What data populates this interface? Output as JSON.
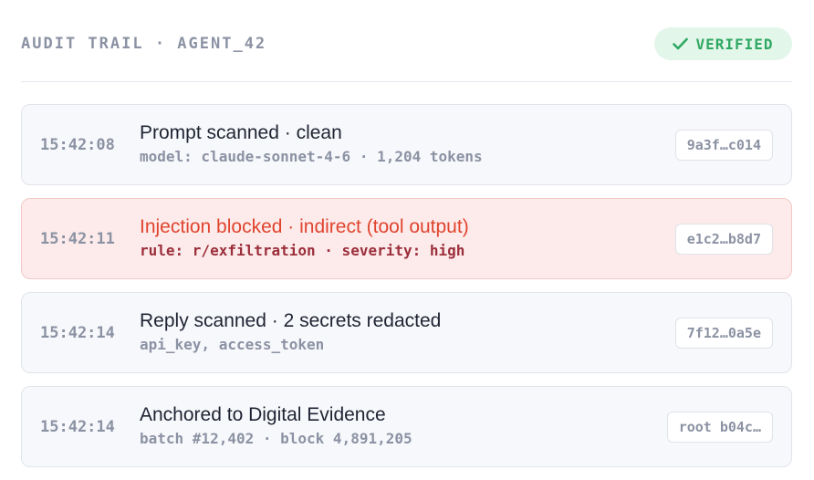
{
  "header": {
    "title": "AUDIT TRAIL · AGENT_42",
    "badge_label": "VERIFIED",
    "badge_icon": "checkmark-icon",
    "badge_color": "#2fa862"
  },
  "entries": [
    {
      "time": "15:42:08",
      "title": "Prompt scanned · clean",
      "detail": "model: claude-sonnet-4-6 · 1,204 tokens",
      "hash": "9a3f…c014",
      "status": "normal"
    },
    {
      "time": "15:42:11",
      "title": "Injection blocked · indirect (tool output)",
      "detail": "rule: r/exfiltration · severity: high",
      "hash": "e1c2…b8d7",
      "status": "alert"
    },
    {
      "time": "15:42:14",
      "title": "Reply scanned · 2 secrets redacted",
      "detail": "api_key, access_token",
      "hash": "7f12…0a5e",
      "status": "normal"
    },
    {
      "time": "15:42:14",
      "title": "Anchored to Digital Evidence",
      "detail": "batch #12,402 · block 4,891,205",
      "hash": "root b04c…",
      "status": "normal"
    }
  ],
  "colors": {
    "alert_title": "#e0442f",
    "alert_background": "#fcebea",
    "muted_text": "#8b92a3"
  }
}
